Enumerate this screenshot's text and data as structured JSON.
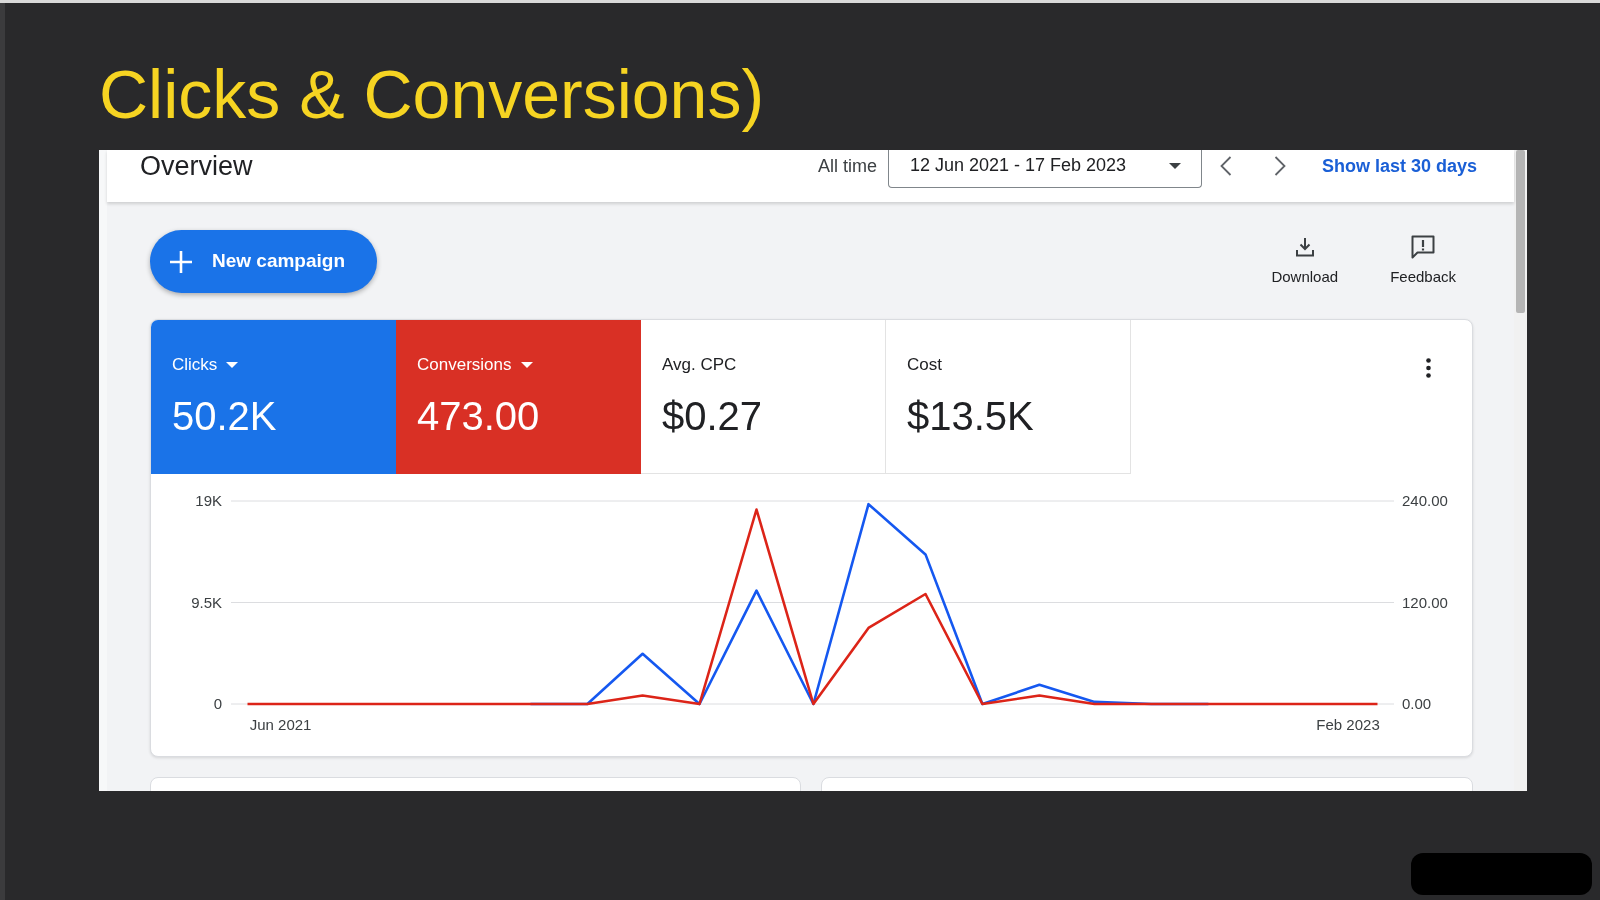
{
  "slide": {
    "title": "Clicks & Conversions)"
  },
  "overview": {
    "header": {
      "title": "Overview",
      "range_label": "All time",
      "date_range": "12 Jun 2021 - 17 Feb 2023",
      "link": "Show last 30 days"
    },
    "toolbar": {
      "primary_button": "New campaign",
      "actions": [
        {
          "kind": "download",
          "label": "Download"
        },
        {
          "kind": "feedback",
          "label": "Feedback"
        }
      ]
    },
    "metrics": [
      {
        "label": "Clicks",
        "value": "50.2K",
        "selected": true,
        "color": "#1a73e8"
      },
      {
        "label": "Conversions",
        "value": "473.00",
        "selected": true,
        "color": "#d93025"
      },
      {
        "label": "Avg. CPC",
        "value": "$0.27",
        "selected": false
      },
      {
        "label": "Cost",
        "value": "$13.5K",
        "selected": false
      }
    ],
    "chart_data": {
      "type": "line",
      "x": [
        "2021-06-12",
        "2021-07-13",
        "2021-08-13",
        "2021-09-12",
        "2021-10-13",
        "2021-11-13",
        "2021-12-14",
        "2022-01-13",
        "2022-02-13",
        "2022-03-16",
        "2022-04-16",
        "2022-05-16",
        "2022-06-16",
        "2022-07-17",
        "2022-08-17",
        "2022-09-16",
        "2022-10-17",
        "2022-11-17",
        "2022-12-18",
        "2023-01-17",
        "2023-02-17"
      ],
      "xlim": [
        "2021-06-03",
        "2023-02-26"
      ],
      "xticks": [
        {
          "value": "2021-06-30",
          "label": "Jun 2021"
        },
        {
          "value": "2023-02-01",
          "label": "Feb 2023"
        }
      ],
      "ylim": [
        0,
        19000
      ],
      "yticks": [
        {
          "value": 0,
          "label": "0"
        },
        {
          "value": 9500,
          "label": "9.5K"
        },
        {
          "value": 19000,
          "label": "19K"
        }
      ],
      "y2lim": [
        0,
        240
      ],
      "y2ticks": [
        {
          "value": 0,
          "label": "0.00"
        },
        {
          "value": 120,
          "label": "120.00"
        },
        {
          "value": 240,
          "label": "240.00"
        }
      ],
      "series": [
        {
          "color": "#1558f0",
          "values": [
            null,
            null,
            null,
            null,
            null,
            0,
            0,
            4700,
            0,
            10600,
            0,
            18700,
            14000,
            0,
            1800,
            200,
            0,
            0,
            null,
            null,
            null
          ]
        },
        {
          "color": "#dc2418",
          "axis": "y2",
          "values": [
            0,
            0,
            0,
            0,
            0,
            0,
            0,
            10,
            0,
            230,
            0,
            90,
            130,
            0,
            10,
            0,
            0,
            0,
            0,
            0,
            0
          ]
        }
      ]
    }
  }
}
